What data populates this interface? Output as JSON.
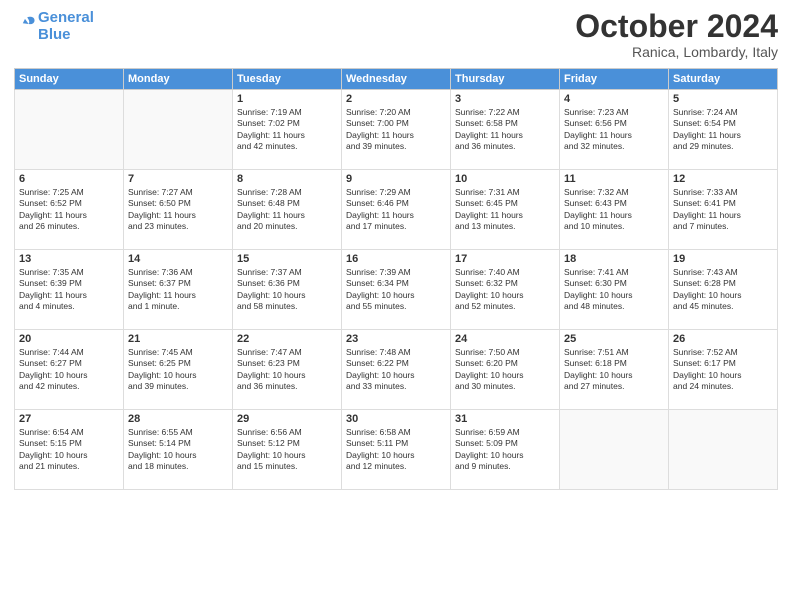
{
  "logo": {
    "line1": "General",
    "line2": "Blue"
  },
  "title": "October 2024",
  "location": "Ranica, Lombardy, Italy",
  "headers": [
    "Sunday",
    "Monday",
    "Tuesday",
    "Wednesday",
    "Thursday",
    "Friday",
    "Saturday"
  ],
  "weeks": [
    [
      {
        "day": "",
        "info": ""
      },
      {
        "day": "",
        "info": ""
      },
      {
        "day": "1",
        "info": "Sunrise: 7:19 AM\nSunset: 7:02 PM\nDaylight: 11 hours\nand 42 minutes."
      },
      {
        "day": "2",
        "info": "Sunrise: 7:20 AM\nSunset: 7:00 PM\nDaylight: 11 hours\nand 39 minutes."
      },
      {
        "day": "3",
        "info": "Sunrise: 7:22 AM\nSunset: 6:58 PM\nDaylight: 11 hours\nand 36 minutes."
      },
      {
        "day": "4",
        "info": "Sunrise: 7:23 AM\nSunset: 6:56 PM\nDaylight: 11 hours\nand 32 minutes."
      },
      {
        "day": "5",
        "info": "Sunrise: 7:24 AM\nSunset: 6:54 PM\nDaylight: 11 hours\nand 29 minutes."
      }
    ],
    [
      {
        "day": "6",
        "info": "Sunrise: 7:25 AM\nSunset: 6:52 PM\nDaylight: 11 hours\nand 26 minutes."
      },
      {
        "day": "7",
        "info": "Sunrise: 7:27 AM\nSunset: 6:50 PM\nDaylight: 11 hours\nand 23 minutes."
      },
      {
        "day": "8",
        "info": "Sunrise: 7:28 AM\nSunset: 6:48 PM\nDaylight: 11 hours\nand 20 minutes."
      },
      {
        "day": "9",
        "info": "Sunrise: 7:29 AM\nSunset: 6:46 PM\nDaylight: 11 hours\nand 17 minutes."
      },
      {
        "day": "10",
        "info": "Sunrise: 7:31 AM\nSunset: 6:45 PM\nDaylight: 11 hours\nand 13 minutes."
      },
      {
        "day": "11",
        "info": "Sunrise: 7:32 AM\nSunset: 6:43 PM\nDaylight: 11 hours\nand 10 minutes."
      },
      {
        "day": "12",
        "info": "Sunrise: 7:33 AM\nSunset: 6:41 PM\nDaylight: 11 hours\nand 7 minutes."
      }
    ],
    [
      {
        "day": "13",
        "info": "Sunrise: 7:35 AM\nSunset: 6:39 PM\nDaylight: 11 hours\nand 4 minutes."
      },
      {
        "day": "14",
        "info": "Sunrise: 7:36 AM\nSunset: 6:37 PM\nDaylight: 11 hours\nand 1 minute."
      },
      {
        "day": "15",
        "info": "Sunrise: 7:37 AM\nSunset: 6:36 PM\nDaylight: 10 hours\nand 58 minutes."
      },
      {
        "day": "16",
        "info": "Sunrise: 7:39 AM\nSunset: 6:34 PM\nDaylight: 10 hours\nand 55 minutes."
      },
      {
        "day": "17",
        "info": "Sunrise: 7:40 AM\nSunset: 6:32 PM\nDaylight: 10 hours\nand 52 minutes."
      },
      {
        "day": "18",
        "info": "Sunrise: 7:41 AM\nSunset: 6:30 PM\nDaylight: 10 hours\nand 48 minutes."
      },
      {
        "day": "19",
        "info": "Sunrise: 7:43 AM\nSunset: 6:28 PM\nDaylight: 10 hours\nand 45 minutes."
      }
    ],
    [
      {
        "day": "20",
        "info": "Sunrise: 7:44 AM\nSunset: 6:27 PM\nDaylight: 10 hours\nand 42 minutes."
      },
      {
        "day": "21",
        "info": "Sunrise: 7:45 AM\nSunset: 6:25 PM\nDaylight: 10 hours\nand 39 minutes."
      },
      {
        "day": "22",
        "info": "Sunrise: 7:47 AM\nSunset: 6:23 PM\nDaylight: 10 hours\nand 36 minutes."
      },
      {
        "day": "23",
        "info": "Sunrise: 7:48 AM\nSunset: 6:22 PM\nDaylight: 10 hours\nand 33 minutes."
      },
      {
        "day": "24",
        "info": "Sunrise: 7:50 AM\nSunset: 6:20 PM\nDaylight: 10 hours\nand 30 minutes."
      },
      {
        "day": "25",
        "info": "Sunrise: 7:51 AM\nSunset: 6:18 PM\nDaylight: 10 hours\nand 27 minutes."
      },
      {
        "day": "26",
        "info": "Sunrise: 7:52 AM\nSunset: 6:17 PM\nDaylight: 10 hours\nand 24 minutes."
      }
    ],
    [
      {
        "day": "27",
        "info": "Sunrise: 6:54 AM\nSunset: 5:15 PM\nDaylight: 10 hours\nand 21 minutes."
      },
      {
        "day": "28",
        "info": "Sunrise: 6:55 AM\nSunset: 5:14 PM\nDaylight: 10 hours\nand 18 minutes."
      },
      {
        "day": "29",
        "info": "Sunrise: 6:56 AM\nSunset: 5:12 PM\nDaylight: 10 hours\nand 15 minutes."
      },
      {
        "day": "30",
        "info": "Sunrise: 6:58 AM\nSunset: 5:11 PM\nDaylight: 10 hours\nand 12 minutes."
      },
      {
        "day": "31",
        "info": "Sunrise: 6:59 AM\nSunset: 5:09 PM\nDaylight: 10 hours\nand 9 minutes."
      },
      {
        "day": "",
        "info": ""
      },
      {
        "day": "",
        "info": ""
      }
    ]
  ]
}
